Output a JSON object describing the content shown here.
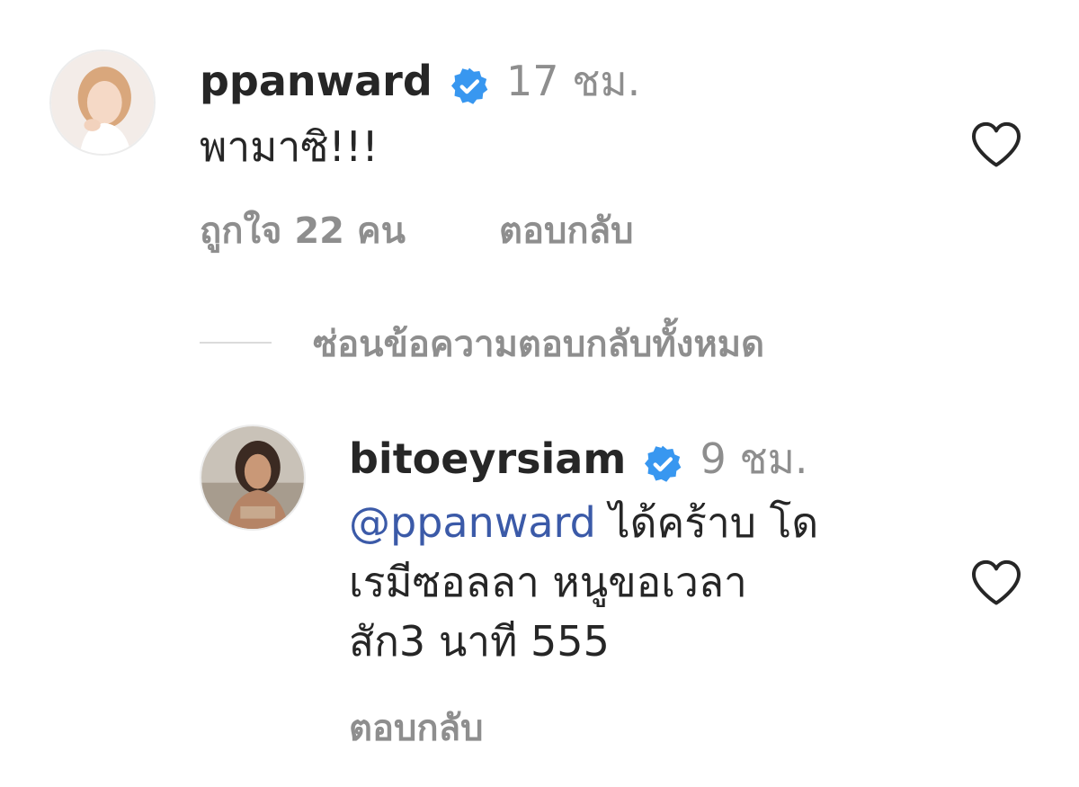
{
  "comment": {
    "username": "ppanward",
    "verified": true,
    "time": "17 ชม.",
    "text": "พามาซิ!!!",
    "likes": "ถูกใจ 22 คน",
    "reply_label": "ตอบกลับ",
    "liked": false
  },
  "replies_toggle": {
    "label": "ซ่อนข้อความตอบกลับทั้งหมด"
  },
  "reply": {
    "username": "bitoeyrsiam",
    "verified": true,
    "time": "9 ชม.",
    "mention": "@ppanward",
    "text_line1": " ได้คร้าบ โด",
    "text_line2": "เรมีซอลลา หนูขอเวลา",
    "text_line3": "สัก3 นาที 555",
    "reply_label": "ตอบกลับ",
    "liked": false
  },
  "colors": {
    "text": "#262626",
    "secondary": "#8e8e8e",
    "verified": "#3897f0",
    "mention": "#3b5aa8"
  }
}
